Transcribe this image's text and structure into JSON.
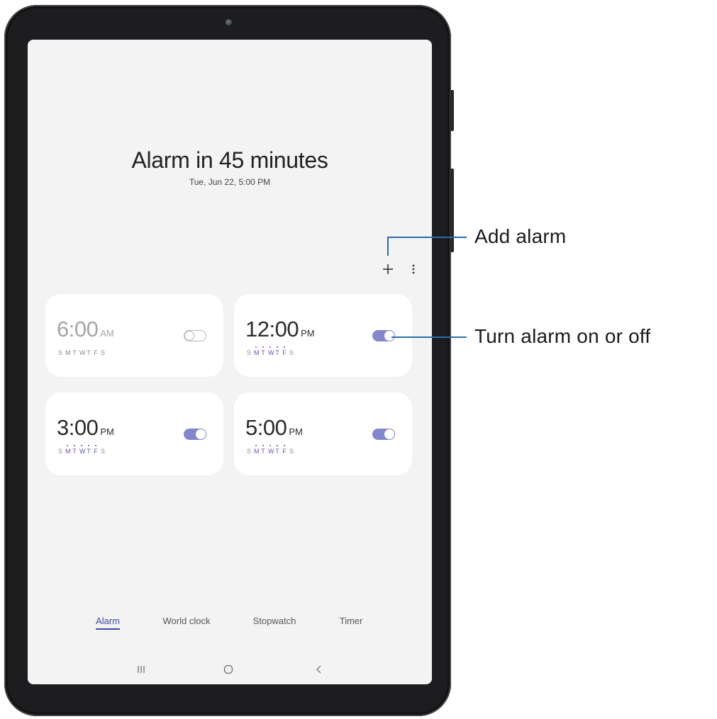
{
  "header": {
    "title": "Alarm in 45 minutes",
    "subtitle": "Tue, Jun 22, 5:00 PM"
  },
  "toolbar": {
    "add_icon": "plus-icon",
    "more_icon": "more-vertical-icon"
  },
  "alarms": [
    {
      "time": "6:00",
      "ampm": "AM",
      "enabled": false,
      "days": [
        "S",
        "M",
        "T",
        "W",
        "T",
        "F",
        "S"
      ],
      "active_days": []
    },
    {
      "time": "12:00",
      "ampm": "PM",
      "enabled": true,
      "days": [
        "S",
        "M",
        "T",
        "W",
        "T",
        "F",
        "S"
      ],
      "active_days": [
        1,
        2,
        3,
        4,
        5
      ]
    },
    {
      "time": "3:00",
      "ampm": "PM",
      "enabled": true,
      "days": [
        "S",
        "M",
        "T",
        "W",
        "T",
        "F",
        "S"
      ],
      "active_days": [
        1,
        2,
        3,
        4,
        5
      ]
    },
    {
      "time": "5:00",
      "ampm": "PM",
      "enabled": true,
      "days": [
        "S",
        "M",
        "T",
        "W",
        "T",
        "F",
        "S"
      ],
      "active_days": [
        1,
        2,
        3,
        4,
        5
      ]
    }
  ],
  "tabs": [
    {
      "label": "Alarm",
      "active": true
    },
    {
      "label": "World clock",
      "active": false
    },
    {
      "label": "Stopwatch",
      "active": false
    },
    {
      "label": "Timer",
      "active": false
    }
  ],
  "navbar": {
    "recents_icon": "recents-icon",
    "home_icon": "home-icon",
    "back_icon": "back-icon"
  },
  "callouts": {
    "add_alarm": "Add alarm",
    "toggle": "Turn alarm on or off"
  },
  "colors": {
    "accent": "#5a57b8",
    "toggle_on": "#8587cc",
    "callout_line": "#2d6cab",
    "screen_bg": "#f3f3f3"
  }
}
